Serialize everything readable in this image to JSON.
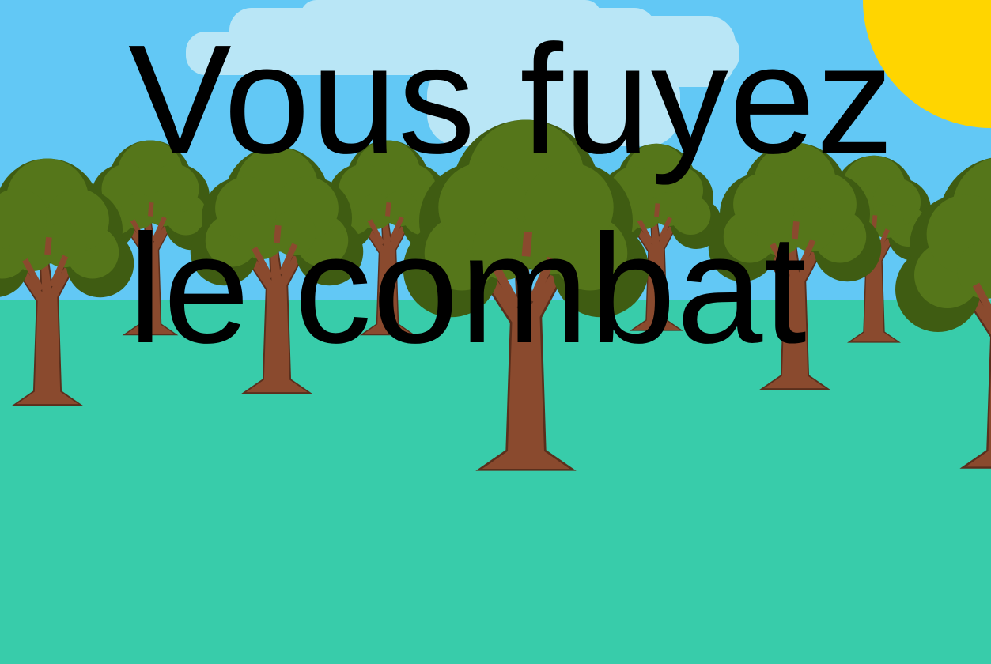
{
  "scene": {
    "name": "forest",
    "sky_color": "#62c8f5",
    "ground_color": "#38ccaa",
    "sun_color": "#ffd500",
    "cloud_color": "#b9e6f6",
    "foliage_color": "#4f6f17",
    "trunk_color": "#8a4a2e"
  },
  "message": {
    "line1": "Vous fuyez",
    "line2": "le combat"
  }
}
